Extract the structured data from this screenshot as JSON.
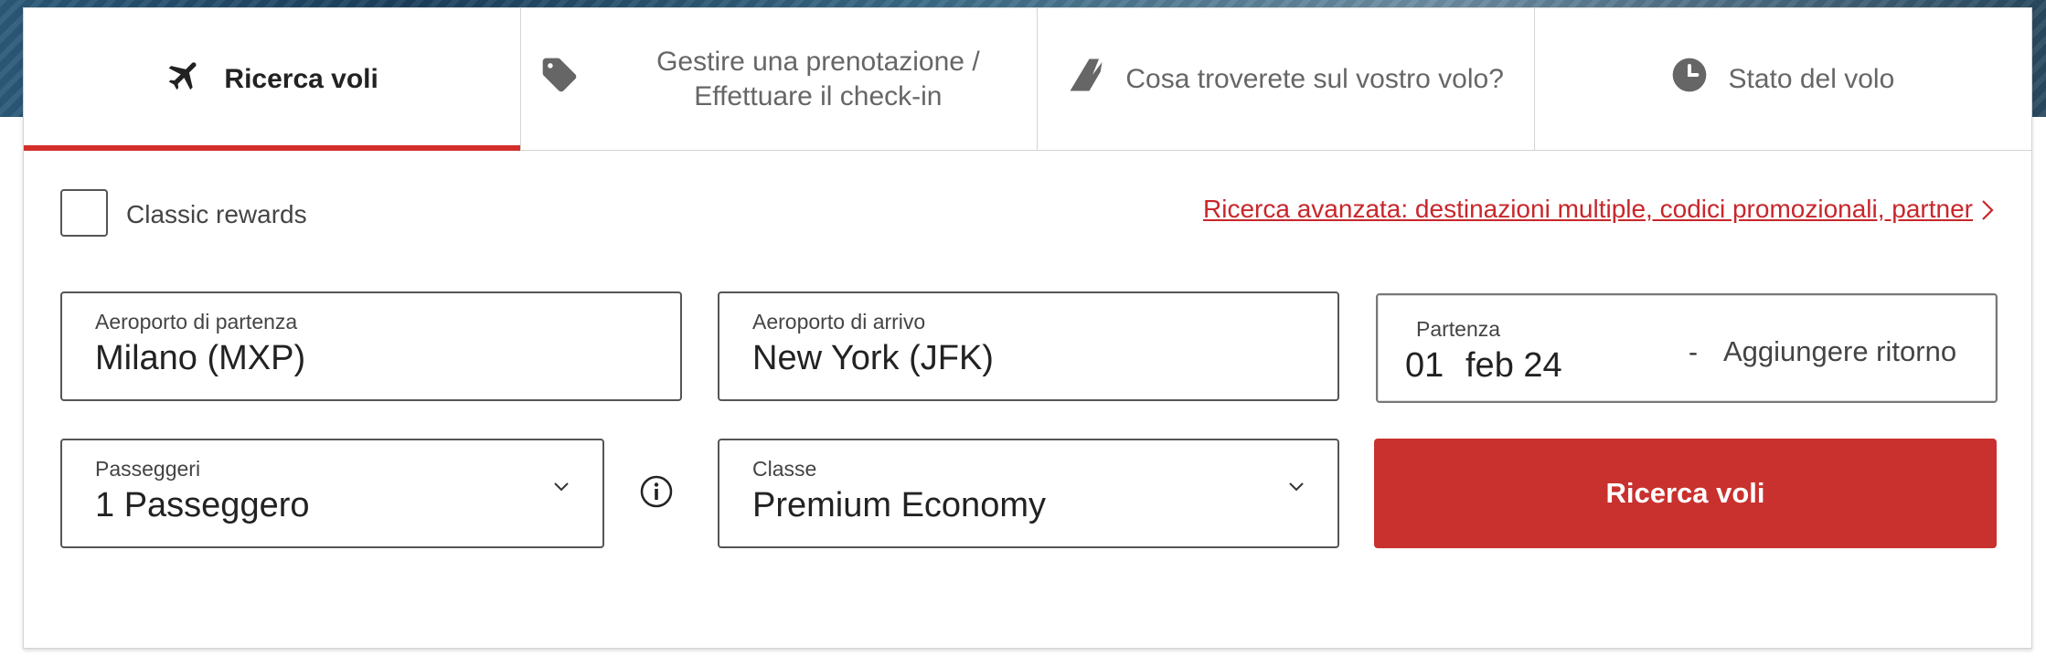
{
  "tabs": [
    {
      "label": "Ricerca voli",
      "icon": "airplane-icon",
      "active": true
    },
    {
      "label": "Gestire una prenotazione / Effettuare il check-in",
      "line1": "Gestire una prenotazione /",
      "line2": "Effettuare il check-in",
      "icon": "tag-icon",
      "active": false
    },
    {
      "label": "Cosa troverete sul vostro volo?",
      "icon": "tail-fin-icon",
      "active": false
    },
    {
      "label": "Stato del volo",
      "icon": "clock-icon",
      "active": false
    }
  ],
  "options": {
    "classic_rewards_label": "Classic rewards",
    "classic_rewards_checked": false,
    "advanced_link": "Ricerca avanzata: destinazioni multiple, codici promozionali, partner"
  },
  "form": {
    "departure": {
      "label": "Aeroporto di partenza",
      "value": "Milano (MXP)"
    },
    "arrival": {
      "label": "Aeroporto di arrivo",
      "value": "New York (JFK)"
    },
    "date": {
      "label": "Partenza",
      "day": "01",
      "month_year": "feb 24",
      "separator": "-",
      "return_label": "Aggiungere ritorno"
    },
    "passengers": {
      "label": "Passeggeri",
      "value": "1 Passeggero"
    },
    "cabin": {
      "label": "Classe",
      "value": "Premium Economy"
    },
    "search_button": "Ricerca voli"
  },
  "colors": {
    "accent": "#c8312e",
    "link": "#c8262b",
    "tab_active_bar": "#d42e2b"
  }
}
